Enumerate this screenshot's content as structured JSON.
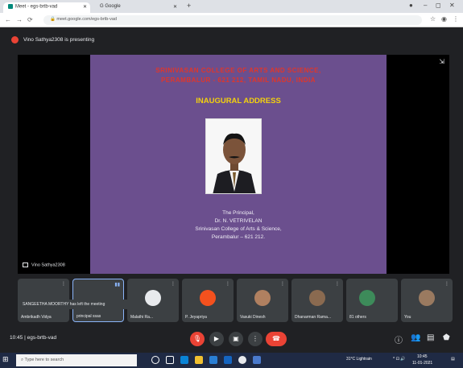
{
  "browser": {
    "tabs": [
      {
        "label": "Meet - egs-brtb-vad",
        "icon": "meet-icon"
      },
      {
        "label": "G Google",
        "icon": "google-icon"
      }
    ],
    "new_tab_label": "+",
    "url": "meet.google.com/egs-brtb-vad"
  },
  "meet": {
    "presenting_banner": "Vino Sathya2308 is presenting",
    "slide": {
      "college_line1": "SRINIVASAN COLLEGE OF ARTS AND SCIENCE,",
      "college_line2": "PERAMBALUR - 621 212, TAMIL NADU, INDIA",
      "heading": "INAUGURAL ADDRESS",
      "credit_role": "The Principal,",
      "credit_name": "Dr. N. VETRIVELAN",
      "credit_college": "Srinivasan College of Arts & Science,",
      "credit_place": "Perambalur – 621 212."
    },
    "stage_name": "Vino Sathya2308",
    "participants": [
      {
        "name": "Ambrikadh Vidya",
        "avatar_color": "#5f6368"
      },
      {
        "name": "principal ssas",
        "avatar_color": "#5f6368"
      },
      {
        "name": "Malathi Ra...",
        "avatar_color": "#e8eaed"
      },
      {
        "name": "P. Jeyapriya",
        "avatar_color": "#f4511e"
      },
      {
        "name": "Vasuki Dinesh",
        "avatar_color": "#b08060"
      },
      {
        "name": "Dhanarman Rama...",
        "avatar_color": "#8a6a50"
      },
      {
        "name": "81 others",
        "avatar_color": "#3d8b5a"
      },
      {
        "name": "You",
        "avatar_color": "#9a7a60"
      }
    ],
    "toast": "SANGEETHA MOORTHY has left the meeting",
    "time": "10:45",
    "meeting_code": "egs-brtb-vad"
  },
  "taskbar": {
    "search_placeholder": "Type here to search",
    "weather": "31°C Lightrain",
    "time": "10:45",
    "date": "11-01-2021"
  },
  "colors": {
    "slide_bg": "#6b4f8e",
    "college_red": "#e0362b",
    "heading_yellow": "#f3d10e",
    "meet_bg": "#202124"
  }
}
